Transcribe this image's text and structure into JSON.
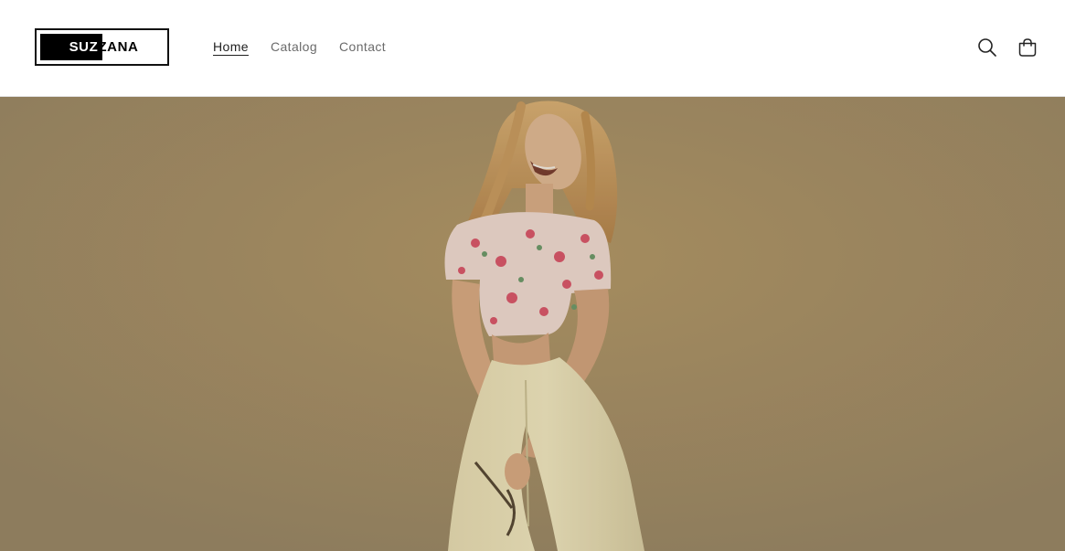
{
  "header": {
    "logo": {
      "part1": "SUZ",
      "part2": "ZANA"
    },
    "nav": [
      {
        "label": "Home",
        "active": true
      },
      {
        "label": "Catalog",
        "active": false
      },
      {
        "label": "Contact",
        "active": false
      }
    ],
    "icons": {
      "search": "search-icon",
      "cart": "cart-icon"
    }
  },
  "hero": {
    "image": "woman-laughing-in-floral-crop-top-and-cream-trousers",
    "colors": {
      "background": "#a98f5e",
      "top": "#f0d8cc",
      "pants": "#ebe0b4",
      "hair": "#c79a5c",
      "skin": "#d9b08a"
    }
  }
}
